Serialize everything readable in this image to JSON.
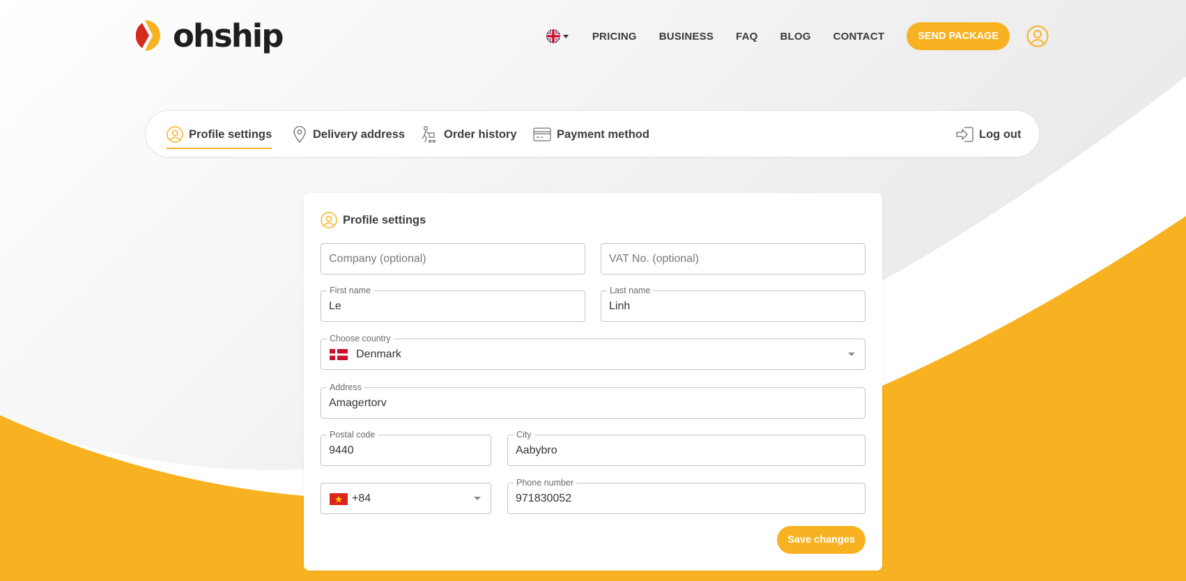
{
  "brand": {
    "name": "ohship",
    "primary_color": "#f8b221",
    "logo_red": "#d62a1b"
  },
  "header": {
    "language_flag_icon": "uk-flag-icon",
    "nav": [
      "PRICING",
      "BUSINESS",
      "FAQ",
      "BLOG",
      "CONTACT"
    ],
    "send_package_label": "SEND PACKAGE",
    "account_icon": "user-circle-icon"
  },
  "tabs": {
    "items": [
      {
        "label": "Profile settings",
        "icon": "user-circle-icon",
        "active": true
      },
      {
        "label": "Delivery address",
        "icon": "location-pin-icon",
        "active": false
      },
      {
        "label": "Order history",
        "icon": "delivery-person-icon",
        "active": false
      },
      {
        "label": "Payment method",
        "icon": "credit-card-icon",
        "active": false
      }
    ],
    "logout_label": "Log out",
    "logout_icon": "logout-icon"
  },
  "card": {
    "title": "Profile settings",
    "title_icon": "user-circle-icon",
    "fields": {
      "company": {
        "placeholder": "Company (optional)",
        "value": ""
      },
      "vat": {
        "placeholder": "VAT No. (optional)",
        "value": ""
      },
      "first_name": {
        "label": "First name",
        "value": "Le"
      },
      "last_name": {
        "label": "Last name",
        "value": "Linh"
      },
      "country": {
        "label": "Choose country",
        "value": "Denmark",
        "flag": "denmark-flag-icon"
      },
      "address": {
        "label": "Address",
        "value": "Amagertorv"
      },
      "postal_code": {
        "label": "Postal code",
        "value": "9440"
      },
      "city": {
        "label": "City",
        "value": "Aabybro"
      },
      "phone_code": {
        "value": "+84",
        "flag": "vietnam-flag-icon"
      },
      "phone_number": {
        "label": "Phone number",
        "value": "971830052"
      }
    },
    "save_label": "Save changes"
  }
}
